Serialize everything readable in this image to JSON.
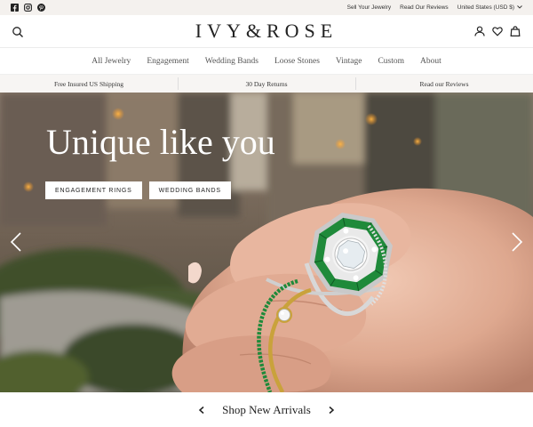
{
  "utility": {
    "links": [
      "Sell Your Jewelry",
      "Read Our Reviews",
      "United States (USD $)"
    ]
  },
  "header": {
    "logo": "IVY&ROSE"
  },
  "nav": {
    "items": [
      "All Jewelry",
      "Engagement",
      "Wedding Bands",
      "Loose Stones",
      "Vintage",
      "Custom",
      "About"
    ]
  },
  "benefits": [
    "Free Insured US Shipping",
    "30 Day Returns",
    "Read our Reviews"
  ],
  "hero": {
    "title": "Unique like you",
    "buttons": [
      "ENGAGEMENT RINGS",
      "WEDDING BANDS"
    ]
  },
  "arrivals": {
    "title": "Shop New Arrivals"
  },
  "icons": {
    "social": [
      "facebook-icon",
      "instagram-icon",
      "pinterest-icon"
    ],
    "header": [
      "search-icon",
      "account-icon",
      "heart-icon",
      "bag-icon"
    ],
    "arrows": [
      "chevron-left-icon",
      "chevron-right-icon"
    ]
  },
  "colors": {
    "utility_bg": "#f4f1ee",
    "benefits_bg": "#f7f5f3",
    "emerald": "#1f8a3a",
    "gold": "#c9a23b"
  }
}
